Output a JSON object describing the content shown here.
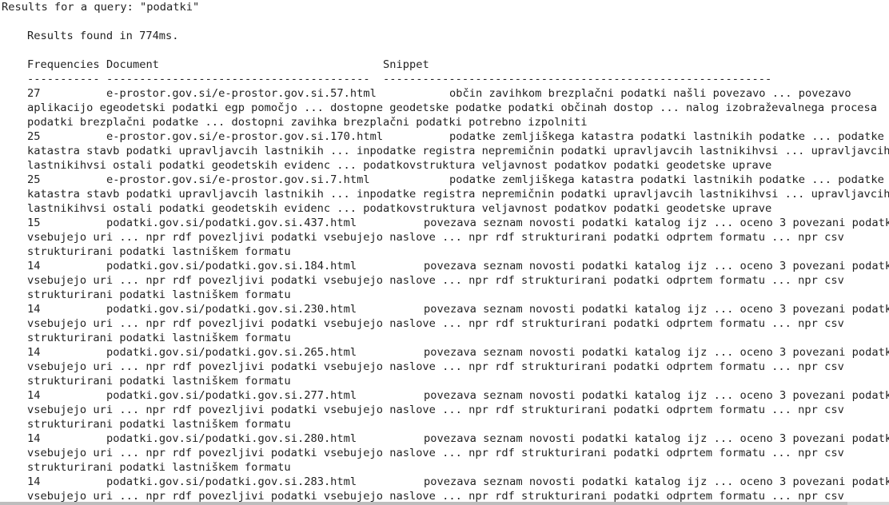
{
  "query_header": "Results for a query: \"podatki\"",
  "timing": "Results found in 774ms.",
  "columns": {
    "frequencies": "Frequencies",
    "document": "Document",
    "snippet": "Snippet",
    "sep_freq": "-----------",
    "sep_doc": "----------------------------------------",
    "sep_snippet": "-----------------------------------------------------------"
  },
  "results": [
    {
      "freq": "27",
      "doc": "e-prostor.gov.si/e-prostor.gov.si.57.html",
      "snippet_first": "občin zavihkom brezplačni podatki našli povezavo ... povezavo",
      "snippet_cont": [
        "aplikacijo egeodetski podatki egp pomočjo ... dostopne geodetske podatke podatki občinah dostop ... nalog izobraževalnega procesa",
        "podatki brezplačni podatke ... dostopni zavihka brezplačni podatki potrebno izpolniti"
      ]
    },
    {
      "freq": "25",
      "doc": "e-prostor.gov.si/e-prostor.gov.si.170.html",
      "snippet_first": "podatke zemljiškega katastra podatki lastnikih podatke ... podatke",
      "snippet_cont": [
        "katastra stavb podatki upravljavcih lastnikih ... inpodatke registra nepremičnin podatki upravljavcih lastnikihvsi ... upravljavcih",
        "lastnikihvsi ostali podatki geodetskih evidenc ... podatkovstruktura veljavnost podatkov podatki geodetske uprave"
      ]
    },
    {
      "freq": "25",
      "doc": "e-prostor.gov.si/e-prostor.gov.si.7.html",
      "snippet_first": "podatke zemljiškega katastra podatki lastnikih podatke ... podatke",
      "snippet_cont": [
        "katastra stavb podatki upravljavcih lastnikih ... inpodatke registra nepremičnin podatki upravljavcih lastnikihvsi ... upravljavcih",
        "lastnikihvsi ostali podatki geodetskih evidenc ... podatkovstruktura veljavnost podatkov podatki geodetske uprave"
      ]
    },
    {
      "freq": "15",
      "doc": "podatki.gov.si/podatki.gov.si.437.html",
      "snippet_first": "povezava seznam novosti podatki katalog ijz ... oceno 3 povezani podatki",
      "snippet_cont": [
        "vsebujejo uri ... npr rdf povezljivi podatki vsebujejo naslove ... npr rdf strukturirani podatki odprtem formatu ... npr csv",
        "strukturirani podatki lastniškem formatu"
      ]
    },
    {
      "freq": "14",
      "doc": "podatki.gov.si/podatki.gov.si.184.html",
      "snippet_first": "povezava seznam novosti podatki katalog ijz ... oceno 3 povezani podatki",
      "snippet_cont": [
        "vsebujejo uri ... npr rdf povezljivi podatki vsebujejo naslove ... npr rdf strukturirani podatki odprtem formatu ... npr csv",
        "strukturirani podatki lastniškem formatu"
      ]
    },
    {
      "freq": "14",
      "doc": "podatki.gov.si/podatki.gov.si.230.html",
      "snippet_first": "povezava seznam novosti podatki katalog ijz ... oceno 3 povezani podatki",
      "snippet_cont": [
        "vsebujejo uri ... npr rdf povezljivi podatki vsebujejo naslove ... npr rdf strukturirani podatki odprtem formatu ... npr csv",
        "strukturirani podatki lastniškem formatu"
      ]
    },
    {
      "freq": "14",
      "doc": "podatki.gov.si/podatki.gov.si.265.html",
      "snippet_first": "povezava seznam novosti podatki katalog ijz ... oceno 3 povezani podatki",
      "snippet_cont": [
        "vsebujejo uri ... npr rdf povezljivi podatki vsebujejo naslove ... npr rdf strukturirani podatki odprtem formatu ... npr csv",
        "strukturirani podatki lastniškem formatu"
      ]
    },
    {
      "freq": "14",
      "doc": "podatki.gov.si/podatki.gov.si.277.html",
      "snippet_first": "povezava seznam novosti podatki katalog ijz ... oceno 3 povezani podatki",
      "snippet_cont": [
        "vsebujejo uri ... npr rdf povezljivi podatki vsebujejo naslove ... npr rdf strukturirani podatki odprtem formatu ... npr csv",
        "strukturirani podatki lastniškem formatu"
      ]
    },
    {
      "freq": "14",
      "doc": "podatki.gov.si/podatki.gov.si.280.html",
      "snippet_first": "povezava seznam novosti podatki katalog ijz ... oceno 3 povezani podatki",
      "snippet_cont": [
        "vsebujejo uri ... npr rdf povezljivi podatki vsebujejo naslove ... npr rdf strukturirani podatki odprtem formatu ... npr csv",
        "strukturirani podatki lastniškem formatu"
      ]
    },
    {
      "freq": "14",
      "doc": "podatki.gov.si/podatki.gov.si.283.html",
      "snippet_first": "povezava seznam novosti podatki katalog ijz ... oceno 3 povezani podatki",
      "snippet_cont": [
        "vsebujejo uri ... npr rdf povezljivi podatki vsebujejo naslove ... npr rdf strukturirani podatki odprtem formatu ... npr csv"
      ]
    }
  ]
}
